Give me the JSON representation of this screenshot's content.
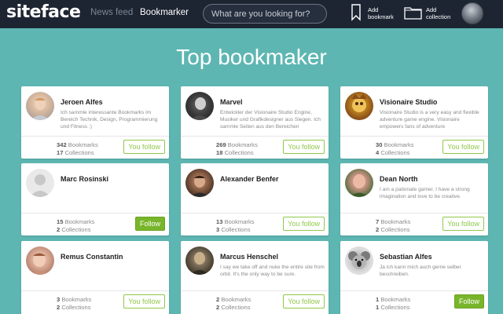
{
  "header": {
    "logo": "siteface",
    "nav": [
      {
        "label": "News feed",
        "active": false
      },
      {
        "label": "Bookmarker",
        "active": true
      }
    ],
    "search_placeholder": "What are you looking for?",
    "actions": [
      {
        "label": "Add bookmark",
        "icon": "bookmark-icon"
      },
      {
        "label": "Add collection",
        "icon": "folder-icon"
      }
    ],
    "avatar_icon": "user-avatar"
  },
  "page_title": "Top bookmaker",
  "colors": {
    "background": "#5eb6b2",
    "topbar": "#1d2533",
    "follow_green": "#79b52b",
    "outline_green": "#8fc94a"
  },
  "cards": [
    {
      "name": "Jeroen Alfes",
      "desc": "Ich sammle interessante Bookmarks im Bereich Technik, Design, Programmierung und Fitness :)",
      "bookmarks": "342",
      "bookmarks_label": " Bookmarks",
      "collections": "17",
      "collections_label": " Collections",
      "button": "You follow",
      "following": true
    },
    {
      "name": "Marvel",
      "desc": "Entwickler der Visionaire Studio Engine, Musiker und Grafikdesigner aus Siegen. Ich sammle Seiten aus den Bereichen",
      "bookmarks": "269",
      "bookmarks_label": " Bookmarks",
      "collections": "18",
      "collections_label": " Collections",
      "button": "You follow",
      "following": true
    },
    {
      "name": "Visionaire Studio",
      "desc": "Visionaire Studio is a very easy and flexible adventure game engine. Visionaire empowers fans of adventure",
      "bookmarks": "30",
      "bookmarks_label": " Bookmarks",
      "collections": "4",
      "collections_label": " Collections",
      "button": "You follow",
      "following": true
    },
    {
      "name": "Marc Rosinski",
      "desc": "",
      "bookmarks": "15",
      "bookmarks_label": " Bookmarks",
      "collections": "2",
      "collections_label": " Collections",
      "button": "Follow",
      "following": false
    },
    {
      "name": "Alexander Benfer",
      "desc": "",
      "bookmarks": "13",
      "bookmarks_label": " Bookmarks",
      "collections": "3",
      "collections_label": " Collections",
      "button": "You follow",
      "following": true
    },
    {
      "name": "Dean North",
      "desc": "I am a pationate gamer. I have a strong imagination and love to be creative.",
      "bookmarks": "7",
      "bookmarks_label": " Bookmarks",
      "collections": "2",
      "collections_label": " Collections",
      "button": "You follow",
      "following": true
    },
    {
      "name": "Remus Constantin",
      "desc": "",
      "bookmarks": "3",
      "bookmarks_label": " Bookmarks",
      "collections": "2",
      "collections_label": " Collections",
      "button": "You follow",
      "following": true
    },
    {
      "name": "Marcus Henschel",
      "desc": "I say we take off and nuke the entire site from orbit. It's the only way to be sure.",
      "bookmarks": "2",
      "bookmarks_label": " Bookmarks",
      "collections": "2",
      "collections_label": " Collections",
      "button": "You follow",
      "following": true
    },
    {
      "name": "Sebastian Alfes",
      "desc": "Ja ich kann mich auch gerne selber beschreiben.",
      "bookmarks": "1",
      "bookmarks_label": " Bookmarks",
      "collections": "1",
      "collections_label": " Collections",
      "button": "Follow",
      "following": false
    }
  ]
}
